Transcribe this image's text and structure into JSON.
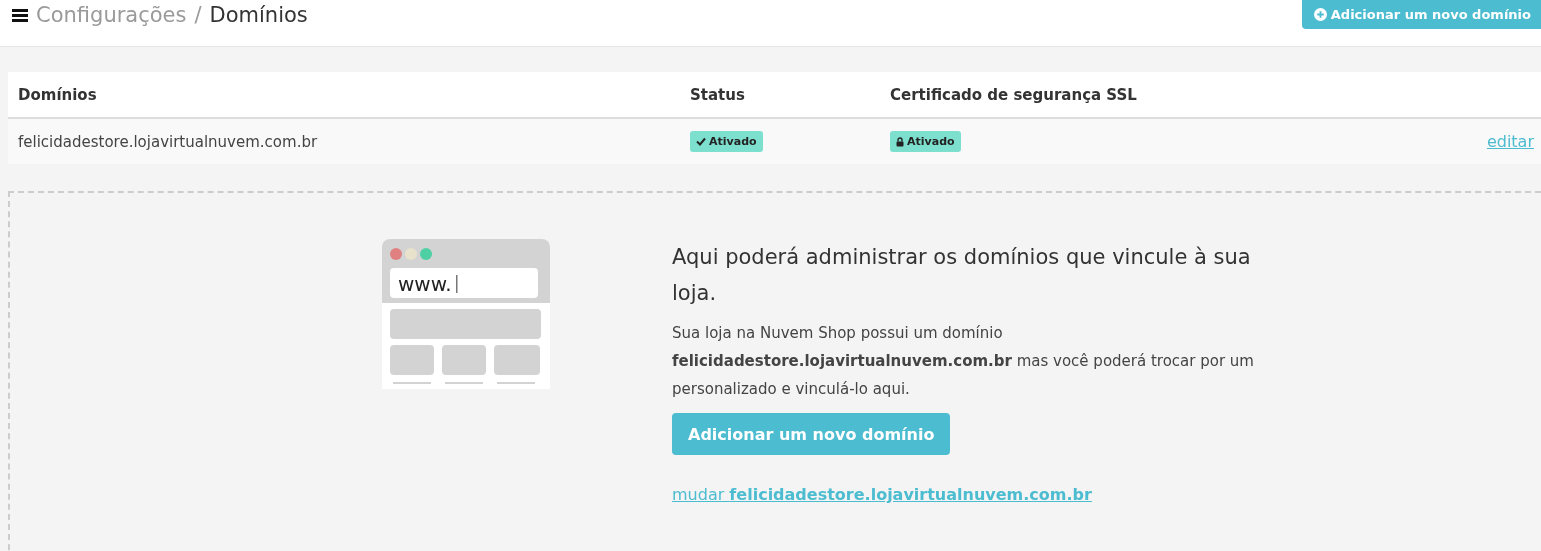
{
  "breadcrumb": {
    "parent": "Configurações",
    "separator": "/",
    "current": "Domínios"
  },
  "header_button": "Adicionar um novo domínio",
  "table": {
    "columns": [
      "Domínios",
      "Status",
      "Certificado de segurança SSL"
    ],
    "rows": [
      {
        "domain": "felicidadestore.lojavirtualnuvem.com.br",
        "status": {
          "kind": "check",
          "label": "Ativado"
        },
        "ssl": {
          "kind": "lock",
          "label": "Ativado"
        },
        "action": "editar"
      }
    ]
  },
  "empty_state": {
    "illustration_text": "www.",
    "heading": "Aqui poderá administrar os domínios que vincule à sua loja.",
    "description": "Sua loja na Nuvem Shop possui um domínio **felicidadestore.lojavirtualnuvem.com.br** mas você poderá trocar por um personalizado e vinculá-lo aqui.",
    "button": "Adicionar um novo domínio",
    "link": "mudar **felicidadestore.lojavirtualnuvem.com.br**"
  }
}
